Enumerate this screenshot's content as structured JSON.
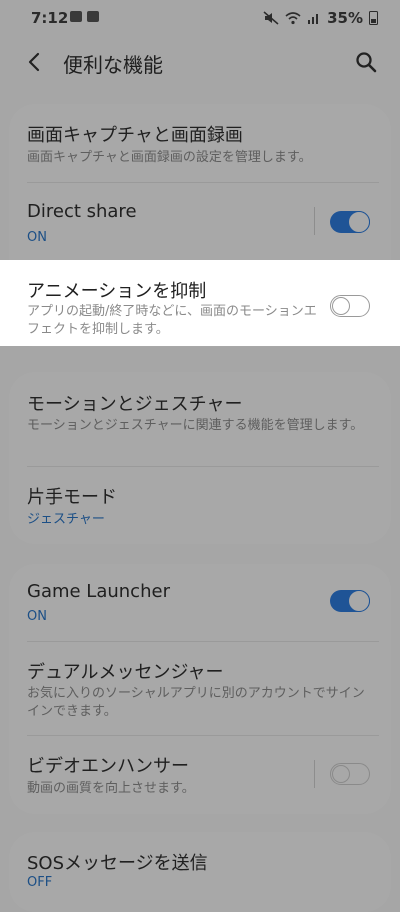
{
  "status_bar": {
    "time": "7:12",
    "battery": "35%"
  },
  "app_bar": {
    "title": "便利な機能"
  },
  "items": {
    "screenshots": {
      "title": "画面キャプチャと画面録画",
      "sub": "画面キャプチャと画面録画の設定を管理します。"
    },
    "direct_share": {
      "title": "Direct share",
      "status": "ON"
    },
    "reduce_animations": {
      "title": "アニメーションを抑制",
      "sub": "アプリの起動/終了時などに、画面のモーションエフェクトを抑制します。"
    },
    "motions": {
      "title": "モーションとジェスチャー",
      "sub": "モーションとジェスチャーに関連する機能を管理します。"
    },
    "one_hand": {
      "title": "片手モード",
      "status": "ジェスチャー"
    },
    "game_launcher": {
      "title": "Game Launcher",
      "status": "ON"
    },
    "dual_messenger": {
      "title": "デュアルメッセンジャー",
      "sub": "お気に入りのソーシャルアプリに別のアカウントでサインインできます。"
    },
    "video_enhancer": {
      "title": "ビデオエンハンサー",
      "sub": "動画の画質を向上させます。"
    },
    "sos": {
      "title": "SOSメッセージを送信",
      "status": "OFF"
    }
  },
  "toggles": {
    "direct_share": "on",
    "reduce_animations": "off",
    "game_launcher": "on",
    "video_enhancer": "off"
  },
  "colors": {
    "accent": "#1f5496",
    "dim_background": "#a6a6a6",
    "highlight": "#ffffff"
  }
}
